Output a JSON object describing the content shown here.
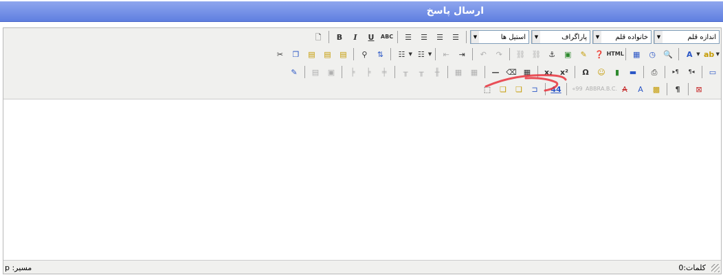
{
  "window": {
    "title": "ارسال پاسخ"
  },
  "toolbar": {
    "font_size_select": "اندازه قلم",
    "font_family_select": "خانواده قلم",
    "format_select": "پاراگراف",
    "styles_select": "استیل ها",
    "bold_label": "B",
    "italic_label": "I",
    "underline_label": "U",
    "strike_label": "ABC",
    "html_label": "HTML",
    "sub_label": "x₂",
    "sup_label": "x²",
    "omega_label": "Ω",
    "format_a_label": "A",
    "forecolor_label": "A",
    "backcolor_label": "ab",
    "pilcrow_label": "¶",
    "cite_label": "«99",
    "abbr_label": "ABBR",
    "acronym_label": "A.B.C.",
    "del_label": "A",
    "ins_label": "A",
    "hr_label": "—",
    "style_label": "44"
  },
  "icons": {
    "row1": [
      "new-document-icon",
      "bold-icon",
      "italic-icon",
      "underline-icon",
      "strikethrough-icon",
      "align-right-icon",
      "align-center-icon",
      "align-left-icon",
      "justify-icon"
    ],
    "row2": [
      "cut-icon",
      "copy-icon",
      "paste-icon",
      "paste-text-icon",
      "paste-word-icon",
      "find-icon",
      "replace-icon",
      "bullet-list-icon",
      "numbered-list-icon",
      "outdent-icon",
      "indent-icon",
      "undo-icon",
      "redo-icon",
      "link-icon",
      "unlink-icon",
      "anchor-icon",
      "image-icon",
      "cleanup-icon",
      "help-icon",
      "html-icon",
      "insert-date-icon",
      "insert-time-icon",
      "preview-icon",
      "forecolor-icon",
      "backcolor-icon"
    ],
    "row3": [
      "edit-icon",
      "table-row-props-icon",
      "table-cell-props-icon",
      "insert-row-before-icon",
      "insert-row-after-icon",
      "delete-row-icon",
      "insert-col-before-icon",
      "insert-col-after-icon",
      "delete-col-icon",
      "split-cells-icon",
      "merge-cells-icon",
      "hr-icon",
      "remove-format-icon",
      "visual-aid-icon",
      "subscript-icon",
      "superscript-icon",
      "charmap-icon",
      "emotions-icon",
      "media-icon",
      "advhr-icon",
      "print-icon",
      "ltr-icon",
      "rtl-icon",
      "fullscreen-icon"
    ],
    "row4": [
      "insert-layer-icon",
      "move-forward-icon",
      "move-backward-icon",
      "absolute-icon",
      "styleprops-icon",
      "cite-icon",
      "abbr-icon",
      "acronym-icon",
      "del-icon",
      "ins-icon",
      "attribs-icon",
      "visualchars-icon",
      "nonbreaking-icon"
    ]
  },
  "statusbar": {
    "path": "مسیر: p",
    "word_count": "کلمات:0"
  },
  "colors": {
    "title_gradient_top": "#8fa6ee",
    "title_gradient_bottom": "#5f7fe0",
    "toolbar_bg": "#f0f0ee",
    "annotation_stroke": "#e8323c"
  }
}
